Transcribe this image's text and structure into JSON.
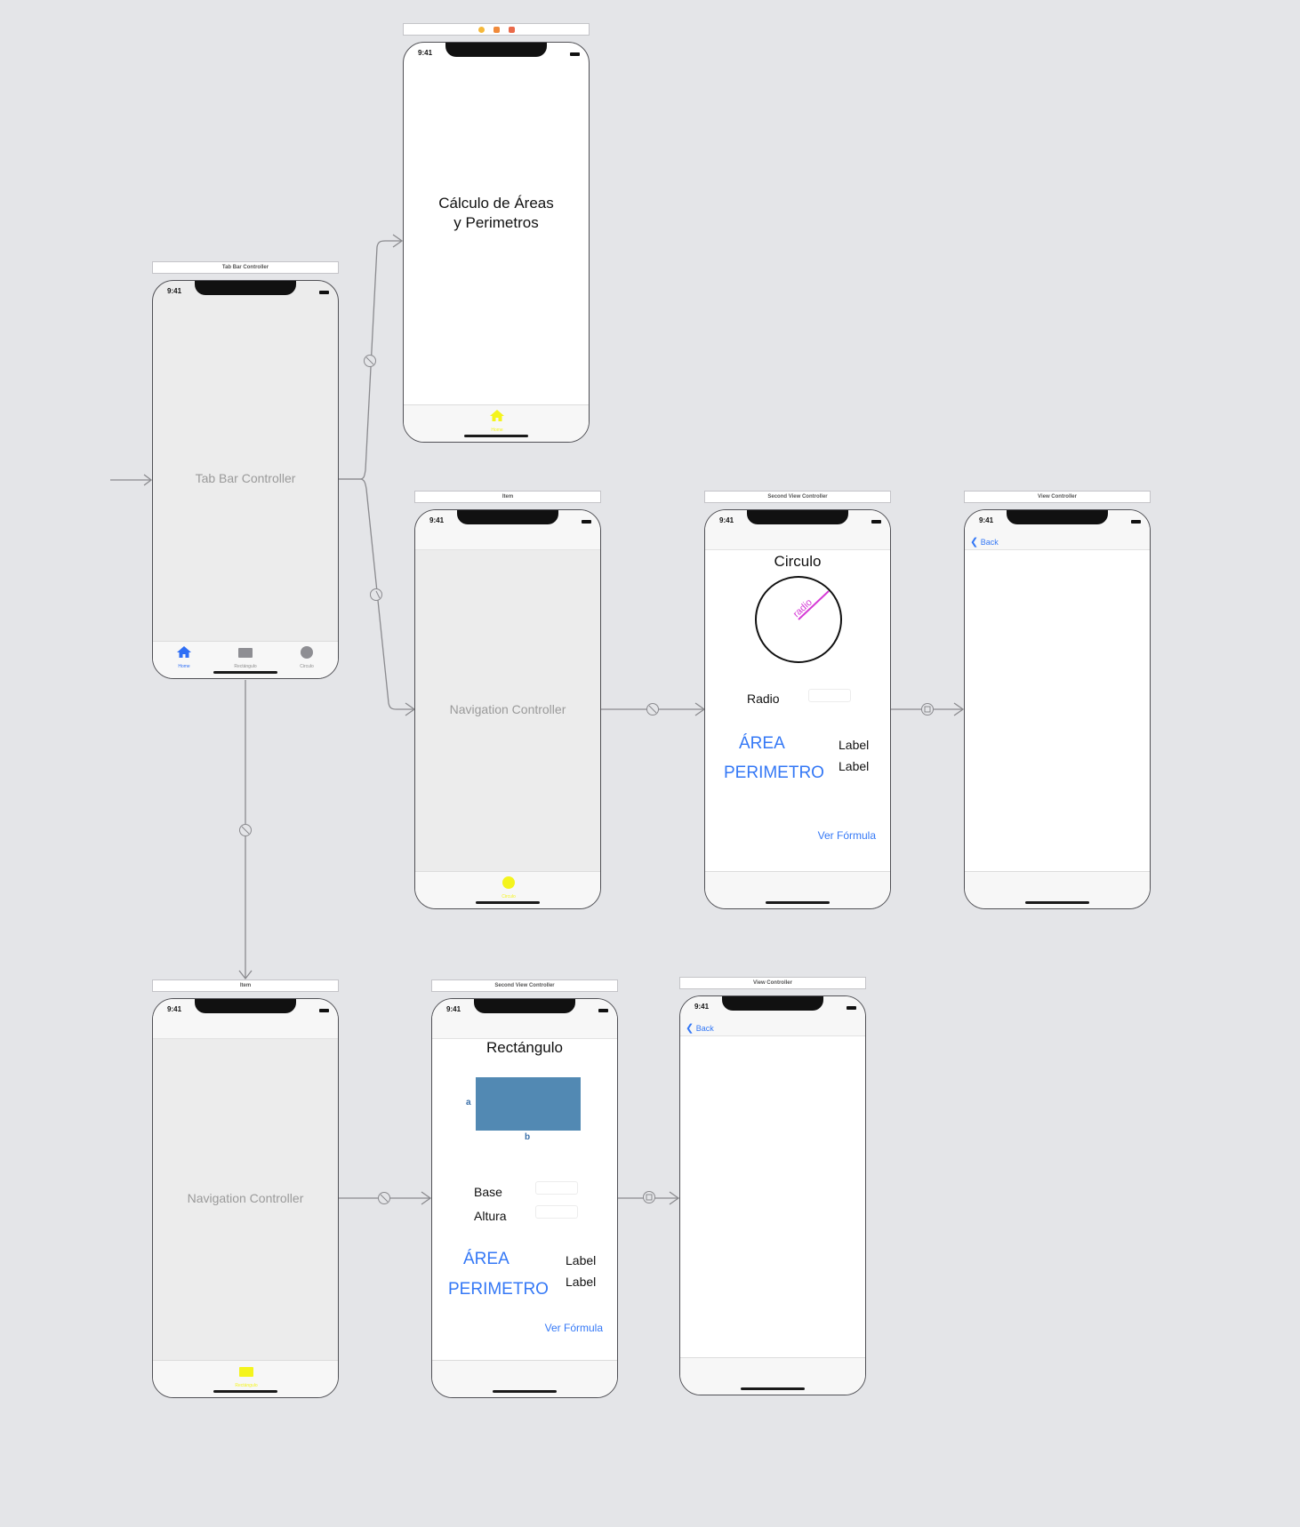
{
  "status_time": "9:41",
  "tab_bar_scene": {
    "title": "Tab Bar Controller",
    "center_label": "Tab Bar Controller",
    "tabs": [
      {
        "label": "Home",
        "icon": "home-icon",
        "active": true
      },
      {
        "label": "Rectángulo",
        "icon": "rectangle-icon",
        "active": false
      },
      {
        "label": "Circulo",
        "icon": "circle-icon",
        "active": false
      }
    ]
  },
  "home_scene": {
    "title_line1": "Cálculo de Áreas",
    "title_line2": "y Perimetros",
    "tab_label": "Home"
  },
  "nav_circle_scene": {
    "title": "Item",
    "center_label": "Navigation Controller",
    "tab_label": "Circulo"
  },
  "circle_scene": {
    "title": "Second View Controller",
    "heading": "Circulo",
    "radius_label": "radio",
    "input_label": "Radio",
    "area_button": "ÁREA",
    "perimeter_button": "PERIMETRO",
    "area_value": "Label",
    "perimeter_value": "Label",
    "formula_button": "Ver Fórmula"
  },
  "circle_detail_scene": {
    "title": "View Controller",
    "back": "Back"
  },
  "nav_rect_scene": {
    "title": "Item",
    "center_label": "Navigation Controller",
    "tab_label": "Rectángulo"
  },
  "rect_scene": {
    "title": "Second View Controller",
    "heading": "Rectángulo",
    "side_a": "a",
    "side_b": "b",
    "base_label": "Base",
    "height_label": "Altura",
    "area_button": "ÁREA",
    "perimeter_button": "PERIMETRO",
    "area_value": "Label",
    "perimeter_value": "Label",
    "formula_button": "Ver Fórmula"
  },
  "rect_detail_scene": {
    "title": "View Controller",
    "back": "Back"
  },
  "colors": {
    "tab_active": "#2e6ef5",
    "placeholder_yellow": "#f4f41d",
    "rect_fill": "#5289b3",
    "radius_line": "#d63ad6",
    "link_blue": "#3478f6"
  }
}
